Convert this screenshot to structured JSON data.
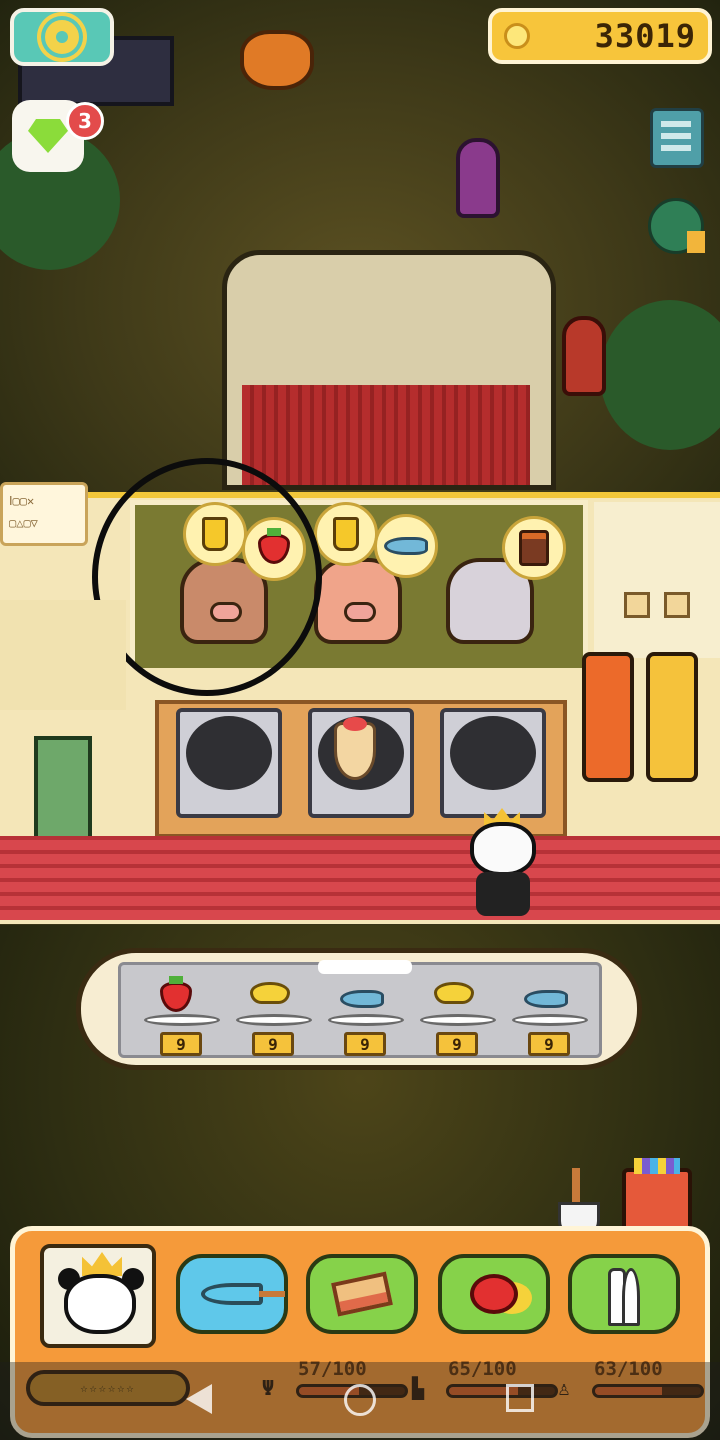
{
  "hud": {
    "coins": "33019",
    "gem_badge_count": "3",
    "settings_icon": "gear-icon",
    "coin_icon": "coin-icon"
  },
  "menu_card": {
    "lines": [
      "Ⅰ▢▢✕",
      "▢△▢▽"
    ]
  },
  "customers": [
    {
      "species": "pig",
      "orders": [
        "juice-icon",
        "strawberry-icon"
      ]
    },
    {
      "species": "pig",
      "orders": [
        "juice-icon",
        "fish-icon"
      ]
    },
    {
      "species": "cat",
      "orders": [
        "jam-jar-icon"
      ]
    }
  ],
  "stoves": [
    {
      "contents": "empty"
    },
    {
      "contents": "strawberry-crepe"
    },
    {
      "contents": "empty"
    }
  ],
  "ingredients": [
    {
      "name": "strawberry",
      "icon": "strawberry-icon",
      "count": "9"
    },
    {
      "name": "banana",
      "icon": "banana-icon",
      "count": "9"
    },
    {
      "name": "fish",
      "icon": "fish-icon",
      "count": "9"
    },
    {
      "name": "banana",
      "icon": "banana-icon",
      "count": "9"
    },
    {
      "name": "fish",
      "icon": "fish-icon",
      "count": "9"
    }
  ],
  "actions": [
    {
      "name": "whisk",
      "icon": "whisk-icon",
      "color": "#5fc8ea"
    },
    {
      "name": "bacon",
      "icon": "bacon-icon",
      "color": "#86d24a"
    },
    {
      "name": "fruit",
      "icon": "fruit-icon",
      "color": "#86d24a"
    },
    {
      "name": "utensils",
      "icon": "utensils-icon",
      "color": "#86d24a"
    }
  ],
  "stats": [
    {
      "name": "food",
      "icon": "utensils-icon",
      "value": 57,
      "max": 100,
      "label": "57/100",
      "color": "#e06a2a"
    },
    {
      "name": "rest",
      "icon": "bed-icon",
      "value": 65,
      "max": 100,
      "label": "65/100",
      "color": "#e06a2a"
    },
    {
      "name": "hygiene",
      "icon": "toilet-icon",
      "value": 63,
      "max": 100,
      "label": "63/100",
      "color": "#e06a2a"
    }
  ],
  "level": {
    "stars": "☆☆☆☆☆☆"
  }
}
